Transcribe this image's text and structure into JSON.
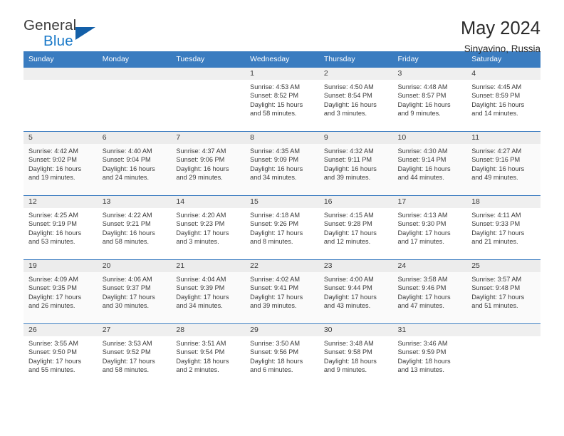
{
  "brand": {
    "name_top": "General",
    "name_bottom": "Blue",
    "flag_color": "#135fa8",
    "text_color": "#3c3c3c",
    "accent_color": "#1878c8"
  },
  "header": {
    "title": "May 2024",
    "subtitle": "Sinyavino, Russia"
  },
  "theme": {
    "header_row_bg": "#3a7cc0",
    "daynum_band_bg": "#efefef",
    "text_color": "#3b3b3b"
  },
  "weekday_headers": [
    "Sunday",
    "Monday",
    "Tuesday",
    "Wednesday",
    "Thursday",
    "Friday",
    "Saturday"
  ],
  "weeks": [
    [
      {
        "empty": true,
        "day": ""
      },
      {
        "empty": true,
        "day": ""
      },
      {
        "empty": true,
        "day": ""
      },
      {
        "empty": false,
        "day": "1",
        "sunrise": "Sunrise: 4:53 AM",
        "sunset": "Sunset: 8:52 PM",
        "daylight_1": "Daylight: 15 hours",
        "daylight_2": "and 58 minutes."
      },
      {
        "empty": false,
        "day": "2",
        "sunrise": "Sunrise: 4:50 AM",
        "sunset": "Sunset: 8:54 PM",
        "daylight_1": "Daylight: 16 hours",
        "daylight_2": "and 3 minutes."
      },
      {
        "empty": false,
        "day": "3",
        "sunrise": "Sunrise: 4:48 AM",
        "sunset": "Sunset: 8:57 PM",
        "daylight_1": "Daylight: 16 hours",
        "daylight_2": "and 9 minutes."
      },
      {
        "empty": false,
        "day": "4",
        "sunrise": "Sunrise: 4:45 AM",
        "sunset": "Sunset: 8:59 PM",
        "daylight_1": "Daylight: 16 hours",
        "daylight_2": "and 14 minutes."
      }
    ],
    [
      {
        "empty": false,
        "day": "5",
        "sunrise": "Sunrise: 4:42 AM",
        "sunset": "Sunset: 9:02 PM",
        "daylight_1": "Daylight: 16 hours",
        "daylight_2": "and 19 minutes."
      },
      {
        "empty": false,
        "day": "6",
        "sunrise": "Sunrise: 4:40 AM",
        "sunset": "Sunset: 9:04 PM",
        "daylight_1": "Daylight: 16 hours",
        "daylight_2": "and 24 minutes."
      },
      {
        "empty": false,
        "day": "7",
        "sunrise": "Sunrise: 4:37 AM",
        "sunset": "Sunset: 9:06 PM",
        "daylight_1": "Daylight: 16 hours",
        "daylight_2": "and 29 minutes."
      },
      {
        "empty": false,
        "day": "8",
        "sunrise": "Sunrise: 4:35 AM",
        "sunset": "Sunset: 9:09 PM",
        "daylight_1": "Daylight: 16 hours",
        "daylight_2": "and 34 minutes."
      },
      {
        "empty": false,
        "day": "9",
        "sunrise": "Sunrise: 4:32 AM",
        "sunset": "Sunset: 9:11 PM",
        "daylight_1": "Daylight: 16 hours",
        "daylight_2": "and 39 minutes."
      },
      {
        "empty": false,
        "day": "10",
        "sunrise": "Sunrise: 4:30 AM",
        "sunset": "Sunset: 9:14 PM",
        "daylight_1": "Daylight: 16 hours",
        "daylight_2": "and 44 minutes."
      },
      {
        "empty": false,
        "day": "11",
        "sunrise": "Sunrise: 4:27 AM",
        "sunset": "Sunset: 9:16 PM",
        "daylight_1": "Daylight: 16 hours",
        "daylight_2": "and 49 minutes."
      }
    ],
    [
      {
        "empty": false,
        "day": "12",
        "sunrise": "Sunrise: 4:25 AM",
        "sunset": "Sunset: 9:19 PM",
        "daylight_1": "Daylight: 16 hours",
        "daylight_2": "and 53 minutes."
      },
      {
        "empty": false,
        "day": "13",
        "sunrise": "Sunrise: 4:22 AM",
        "sunset": "Sunset: 9:21 PM",
        "daylight_1": "Daylight: 16 hours",
        "daylight_2": "and 58 minutes."
      },
      {
        "empty": false,
        "day": "14",
        "sunrise": "Sunrise: 4:20 AM",
        "sunset": "Sunset: 9:23 PM",
        "daylight_1": "Daylight: 17 hours",
        "daylight_2": "and 3 minutes."
      },
      {
        "empty": false,
        "day": "15",
        "sunrise": "Sunrise: 4:18 AM",
        "sunset": "Sunset: 9:26 PM",
        "daylight_1": "Daylight: 17 hours",
        "daylight_2": "and 8 minutes."
      },
      {
        "empty": false,
        "day": "16",
        "sunrise": "Sunrise: 4:15 AM",
        "sunset": "Sunset: 9:28 PM",
        "daylight_1": "Daylight: 17 hours",
        "daylight_2": "and 12 minutes."
      },
      {
        "empty": false,
        "day": "17",
        "sunrise": "Sunrise: 4:13 AM",
        "sunset": "Sunset: 9:30 PM",
        "daylight_1": "Daylight: 17 hours",
        "daylight_2": "and 17 minutes."
      },
      {
        "empty": false,
        "day": "18",
        "sunrise": "Sunrise: 4:11 AM",
        "sunset": "Sunset: 9:33 PM",
        "daylight_1": "Daylight: 17 hours",
        "daylight_2": "and 21 minutes."
      }
    ],
    [
      {
        "empty": false,
        "day": "19",
        "sunrise": "Sunrise: 4:09 AM",
        "sunset": "Sunset: 9:35 PM",
        "daylight_1": "Daylight: 17 hours",
        "daylight_2": "and 26 minutes."
      },
      {
        "empty": false,
        "day": "20",
        "sunrise": "Sunrise: 4:06 AM",
        "sunset": "Sunset: 9:37 PM",
        "daylight_1": "Daylight: 17 hours",
        "daylight_2": "and 30 minutes."
      },
      {
        "empty": false,
        "day": "21",
        "sunrise": "Sunrise: 4:04 AM",
        "sunset": "Sunset: 9:39 PM",
        "daylight_1": "Daylight: 17 hours",
        "daylight_2": "and 34 minutes."
      },
      {
        "empty": false,
        "day": "22",
        "sunrise": "Sunrise: 4:02 AM",
        "sunset": "Sunset: 9:41 PM",
        "daylight_1": "Daylight: 17 hours",
        "daylight_2": "and 39 minutes."
      },
      {
        "empty": false,
        "day": "23",
        "sunrise": "Sunrise: 4:00 AM",
        "sunset": "Sunset: 9:44 PM",
        "daylight_1": "Daylight: 17 hours",
        "daylight_2": "and 43 minutes."
      },
      {
        "empty": false,
        "day": "24",
        "sunrise": "Sunrise: 3:58 AM",
        "sunset": "Sunset: 9:46 PM",
        "daylight_1": "Daylight: 17 hours",
        "daylight_2": "and 47 minutes."
      },
      {
        "empty": false,
        "day": "25",
        "sunrise": "Sunrise: 3:57 AM",
        "sunset": "Sunset: 9:48 PM",
        "daylight_1": "Daylight: 17 hours",
        "daylight_2": "and 51 minutes."
      }
    ],
    [
      {
        "empty": false,
        "day": "26",
        "sunrise": "Sunrise: 3:55 AM",
        "sunset": "Sunset: 9:50 PM",
        "daylight_1": "Daylight: 17 hours",
        "daylight_2": "and 55 minutes."
      },
      {
        "empty": false,
        "day": "27",
        "sunrise": "Sunrise: 3:53 AM",
        "sunset": "Sunset: 9:52 PM",
        "daylight_1": "Daylight: 17 hours",
        "daylight_2": "and 58 minutes."
      },
      {
        "empty": false,
        "day": "28",
        "sunrise": "Sunrise: 3:51 AM",
        "sunset": "Sunset: 9:54 PM",
        "daylight_1": "Daylight: 18 hours",
        "daylight_2": "and 2 minutes."
      },
      {
        "empty": false,
        "day": "29",
        "sunrise": "Sunrise: 3:50 AM",
        "sunset": "Sunset: 9:56 PM",
        "daylight_1": "Daylight: 18 hours",
        "daylight_2": "and 6 minutes."
      },
      {
        "empty": false,
        "day": "30",
        "sunrise": "Sunrise: 3:48 AM",
        "sunset": "Sunset: 9:58 PM",
        "daylight_1": "Daylight: 18 hours",
        "daylight_2": "and 9 minutes."
      },
      {
        "empty": false,
        "day": "31",
        "sunrise": "Sunrise: 3:46 AM",
        "sunset": "Sunset: 9:59 PM",
        "daylight_1": "Daylight: 18 hours",
        "daylight_2": "and 13 minutes."
      },
      {
        "empty": true,
        "day": ""
      }
    ]
  ]
}
